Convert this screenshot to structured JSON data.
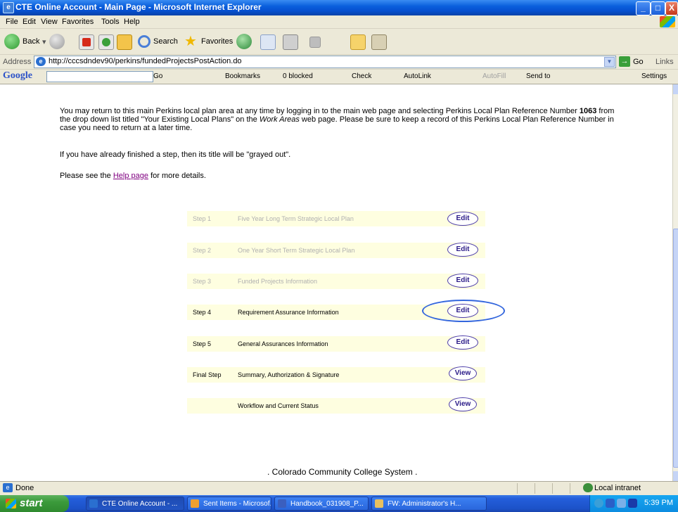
{
  "window": {
    "title": "CTE Online Account - Main Page - Microsoft Internet Explorer",
    "controls": [
      "_",
      "□",
      "X"
    ]
  },
  "menu": [
    "File",
    "Edit",
    "View",
    "Favorites",
    "Tools",
    "Help"
  ],
  "toolbar": {
    "back_label": "Back",
    "search_label": "Search",
    "favorites_label": "Favorites"
  },
  "address": {
    "label": "Address",
    "url": "http://cccsdndev90/perkins/fundedProjectsPostAction.do",
    "go_label": "Go",
    "links_label": "Links"
  },
  "googlebar": {
    "logo": "Google",
    "go": "Go",
    "bookmarks": "Bookmarks",
    "blocked": "0 blocked",
    "check": "Check",
    "autolink": "AutoLink",
    "autofill": "AutoFill",
    "send_to": "Send to",
    "settings": "Settings"
  },
  "content": {
    "intro_prefix": "You may return to this main Perkins local plan area at any time by logging in to the main web page and selecting Perkins Local Plan Reference Number",
    "reference_number": "1063",
    "intro_middle": "from the drop down list titled \"Your Existing Local Plans\" on the",
    "work_areas": "Work Areas",
    "intro_suffix": "web page. Please be sure to keep a record of this Perkins Local Plan Reference Number in case you need to return at a later time.",
    "grayed_note": "If you have already finished a step, then its title will be \"grayed out\".",
    "help_prefix": "Please see the",
    "help_link": "Help page",
    "help_suffix": "for more details.",
    "footer": ". Colorado Community College System ."
  },
  "steps": [
    {
      "num": "Step 1",
      "name": "Five Year Long Term Strategic Local Plan",
      "action": "Edit",
      "done": true
    },
    {
      "num": "Step 2",
      "name": "One Year Short Term Strategic Local Plan",
      "action": "Edit",
      "done": true
    },
    {
      "num": "Step 3",
      "name": "Funded Projects Information",
      "action": "Edit",
      "done": true
    },
    {
      "num": "Step 4",
      "name": "Requirement Assurance Information",
      "action": "Edit",
      "done": false
    },
    {
      "num": "Step 5",
      "name": "General Assurances Information",
      "action": "Edit",
      "done": false
    },
    {
      "num": "Final Step",
      "name": "Summary, Authorization & Signature",
      "action": "View",
      "done": false
    },
    {
      "num": "",
      "name": "Workflow and Current Status",
      "action": "View",
      "done": false
    }
  ],
  "status": {
    "text": "Done",
    "zone": "Local intranet"
  },
  "taskbar": {
    "start": "start",
    "tasks": [
      "CTE Online Account - ...",
      "Sent Items - Microsof...",
      "Handbook_031908_P...",
      "FW: Administrator's H..."
    ],
    "clock": "5:39 PM"
  }
}
